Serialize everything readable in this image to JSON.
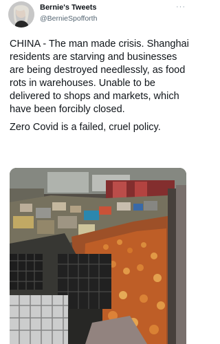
{
  "tweet": {
    "display_name": "Bernie's Tweets",
    "handle": "@BernieSpofforth",
    "more_label": "···",
    "text_paragraph_1": "CHINA - The man made crisis. Shanghai residents are starving and businesses are being destroyed needlessly, as food rots in warehouses. Unable to be delivered to shops and markets, which have been forcibly closed.",
    "text_paragraph_2": "Zero Covid is a failed, cruel policy."
  },
  "icons": {
    "avatar": "profile-photo",
    "more": "more-options-icon"
  },
  "colors": {
    "text": "#0f1419",
    "secondary_text": "#536471",
    "background": "#ffffff"
  }
}
